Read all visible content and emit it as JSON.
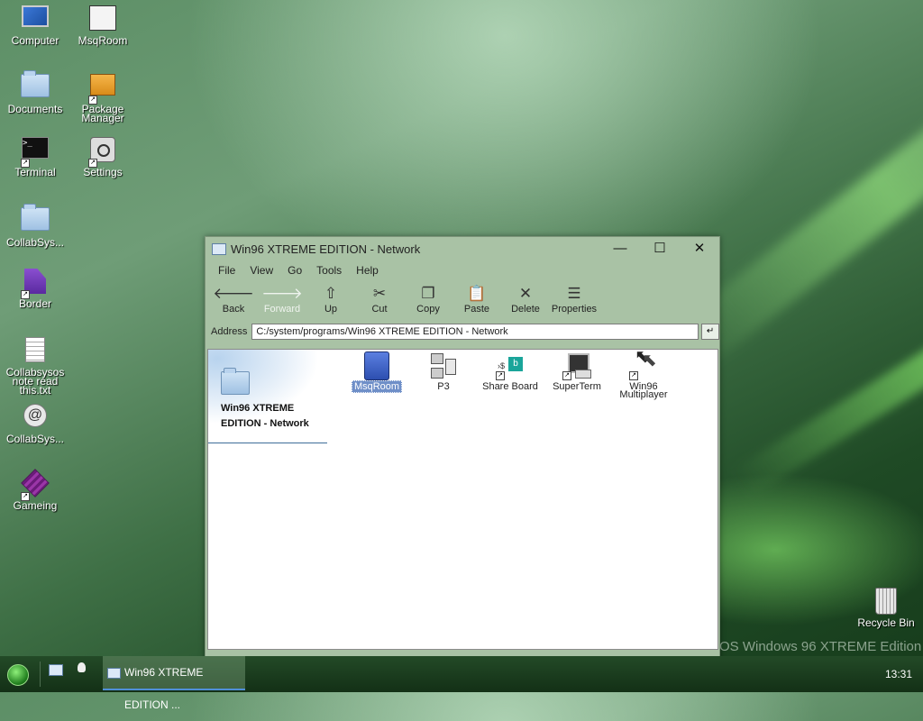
{
  "desktop": {
    "watermark": "OS Windows 96 XTREME Edition",
    "icons": [
      {
        "label": "Computer",
        "icon": "computer-icon"
      },
      {
        "label": "MsqRoom",
        "icon": "msqroom-icon"
      },
      {
        "label": "Documents",
        "icon": "folder-icon"
      },
      {
        "label": "Package Manager",
        "icon": "package-icon"
      },
      {
        "label": "Terminal",
        "icon": "terminal-icon"
      },
      {
        "label": "Settings",
        "icon": "settings-icon"
      },
      {
        "label": "CollabSys...",
        "icon": "folder-icon"
      },
      {
        "label": "Border",
        "icon": "border-icon"
      },
      {
        "label": "Collabsysos note read this.txt",
        "icon": "text-file-icon"
      },
      {
        "label": "CollabSys...",
        "icon": "collabsys-icon"
      },
      {
        "label": "Gameing",
        "icon": "cube-icon"
      },
      {
        "label": "Recycle Bin",
        "icon": "recycle-bin-icon"
      }
    ]
  },
  "window": {
    "title": "Win96 XTREME EDITION - Network",
    "controls": {
      "minimize": "—",
      "maximize": "☐",
      "close": "✕"
    },
    "menu": [
      "File",
      "View",
      "Go",
      "Tools",
      "Help"
    ],
    "toolbar": [
      {
        "label": "Back",
        "glyph": "🡐",
        "enabled": true
      },
      {
        "label": "Forward",
        "glyph": "🡒",
        "enabled": false
      },
      {
        "label": "Up",
        "glyph": "⇧",
        "enabled": true
      },
      {
        "label": "Cut",
        "glyph": "✂",
        "enabled": true
      },
      {
        "label": "Copy",
        "glyph": "❐",
        "enabled": true
      },
      {
        "label": "Paste",
        "glyph": "📋",
        "enabled": true
      },
      {
        "label": "Delete",
        "glyph": "✕",
        "enabled": true
      },
      {
        "label": "Properties",
        "glyph": "☰",
        "enabled": true
      }
    ],
    "address": {
      "label": "Address",
      "value": "C:/system/programs/Win96 XTREME EDITION - Network",
      "go": "↵"
    },
    "sidepanel_title": "Win96 XTREME EDITION - Network",
    "items": [
      {
        "label": "MsqRoom",
        "selected": true
      },
      {
        "label": "P3",
        "selected": false
      },
      {
        "label": "Share Board",
        "selected": false
      },
      {
        "label": "SuperTerm",
        "selected": false
      },
      {
        "label": "Win96 Multiplayer",
        "selected": false
      }
    ]
  },
  "taskbar": {
    "task_label": "Win96 XTREME EDITION ...",
    "clock": "13:31"
  }
}
